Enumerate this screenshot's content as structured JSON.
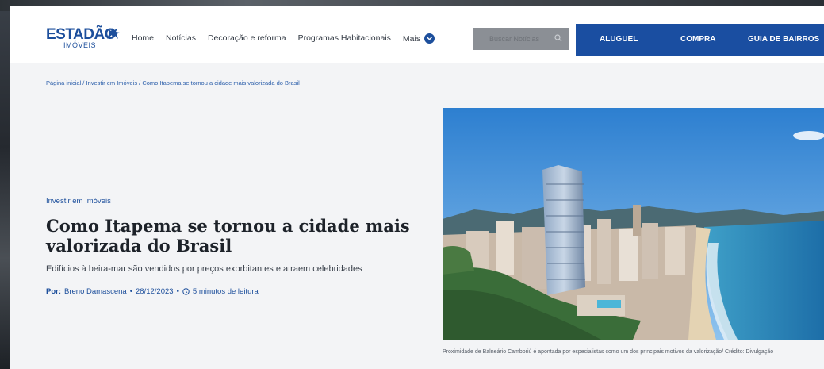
{
  "header": {
    "logo_main": "ESTADÃO",
    "logo_sub": "IMÓVEIS",
    "nav": [
      "Home",
      "Notícias",
      "Decoração e reforma",
      "Programas Habitacionais",
      "Mais"
    ],
    "search_placeholder": "Buscar Notícias",
    "blue_links": [
      "ALUGUEL",
      "COMPRA",
      "GUIA DE BAIRROS"
    ]
  },
  "breadcrumb": {
    "home": "Página inicial",
    "sep": " / ",
    "section": "Investir em Imóveis",
    "current": "Como Itapema se tornou a cidade mais valorizada do Brasil"
  },
  "article": {
    "category": "Investir em Imóveis",
    "title": "Como Itapema se tornou a cidade mais valorizada do Brasil",
    "subtitle": "Edifícios à beira-mar são vendidos por preços exorbitantes e atraem celebridades",
    "by_label": "Por:",
    "author": "Breno Damascena",
    "date": "28/12/2023",
    "read_time": "5 minutos de leitura",
    "caption": "Proximidade de Balneário Camboriú é apontada por especialistas como um dos principais motivos da valorização/ Crédito: Divulgação"
  },
  "colors": {
    "brand_blue": "#1a4ea1",
    "page_bg": "#f3f4f6"
  }
}
